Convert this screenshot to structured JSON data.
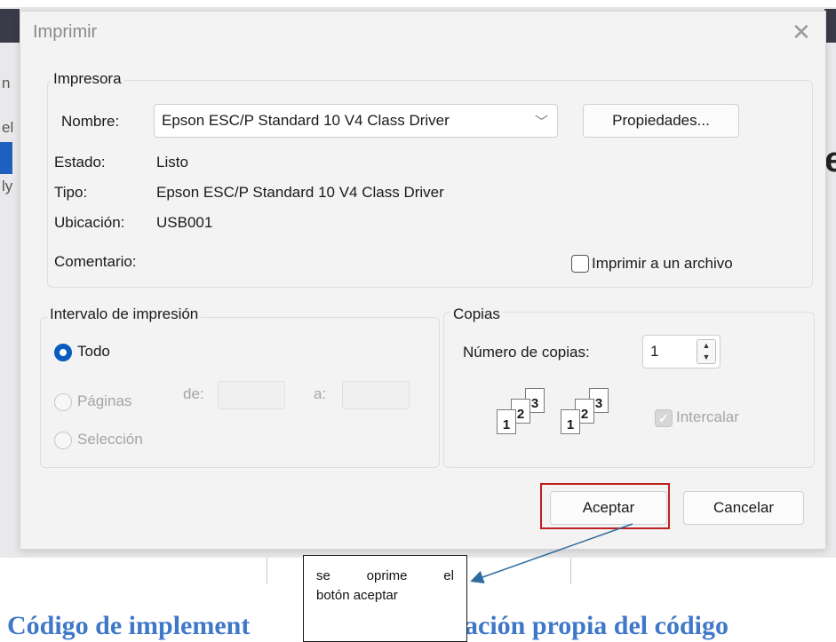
{
  "dialog": {
    "title": "Imprimir",
    "printer_group": {
      "legend": "Impresora",
      "name_label": "Nombre:",
      "name_value": "Epson ESC/P Standard 10 V4 Class Driver",
      "properties_button": "Propiedades...",
      "status_label": "Estado:",
      "status_value": "Listo",
      "type_label": "Tipo:",
      "type_value": "Epson ESC/P Standard 10 V4 Class Driver",
      "location_label": "Ubicación:",
      "location_value": "USB001",
      "comment_label": "Comentario:",
      "print_to_file": "Imprimir a un archivo"
    },
    "range_group": {
      "legend": "Intervalo de impresión",
      "all": "Todo",
      "pages": "Páginas",
      "from_label": "de:",
      "to_label": "a:",
      "selection": "Selección",
      "selected": "Todo"
    },
    "copies_group": {
      "legend": "Copias",
      "copies_label": "Número de copias:",
      "copies_value": "1",
      "collate": "Intercalar",
      "collate_checked": true,
      "collate_pages": [
        "1",
        "2",
        "3"
      ]
    },
    "accept_button": "Aceptar",
    "cancel_button": "Cancelar"
  },
  "annotation": {
    "line1_words": [
      "se",
      "oprime",
      "el"
    ],
    "line2": "botón aceptar",
    "highlight_color": "#c0201f",
    "arrow_color": "#2e6c9e"
  },
  "document": {
    "heading_left": "Código de implement",
    "heading_right": "plicación propia del código",
    "heading_color": "#3f78c8"
  },
  "background": {
    "fragments": [
      "n",
      "el",
      "ly"
    ]
  }
}
